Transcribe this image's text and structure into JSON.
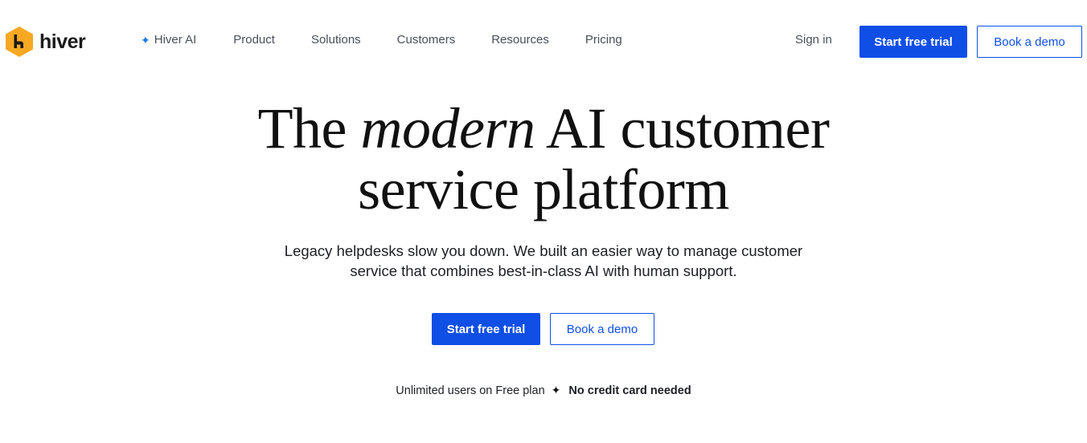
{
  "brand": {
    "name": "hiver",
    "accent_color": "#0f4fe6",
    "logo_color": "#f7a823"
  },
  "nav": {
    "links": [
      {
        "label": "Hiver AI",
        "icon": "sparkle-icon"
      },
      {
        "label": "Product"
      },
      {
        "label": "Solutions"
      },
      {
        "label": "Customers"
      },
      {
        "label": "Resources"
      },
      {
        "label": "Pricing"
      }
    ],
    "sign_in": "Sign in",
    "start_trial": "Start free trial",
    "book_demo": "Book a demo"
  },
  "hero": {
    "title_part1": "The ",
    "title_em": "modern",
    "title_part2": " AI customer",
    "title_line2": "service platform",
    "subtitle_line1": "Legacy helpdesks slow you down. We built an easier way to manage customer",
    "subtitle_line2": "service that combines best-in-class AI with human support.",
    "start_trial": "Start free trial",
    "book_demo": "Book a demo"
  },
  "footnote": {
    "left": "Unlimited users on Free plan",
    "separator": "✦",
    "right": "No credit card needed"
  }
}
